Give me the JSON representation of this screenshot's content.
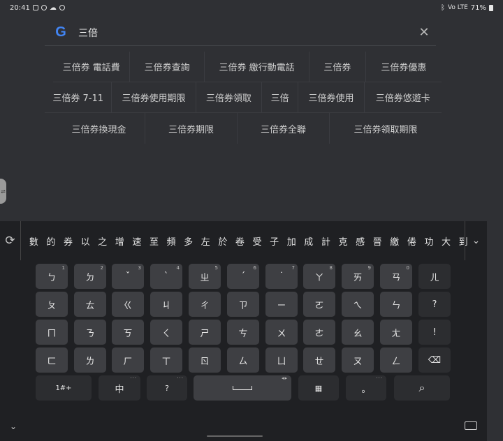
{
  "status": {
    "time": "20:41",
    "battery": "71%",
    "signal": "Vo LTE"
  },
  "search": {
    "query": "三倍",
    "clear_label": "✕",
    "logo": "G"
  },
  "suggestions": [
    [
      "三倍券 電話費",
      "三倍券查詢",
      "三倍券 繳行動電話",
      "三倍券",
      "三倍券優惠"
    ],
    [
      "三倍券 7-11",
      "三倍券使用期限",
      "三倍券領取",
      "三倍",
      "三倍券使用",
      "三倍券悠遊卡"
    ],
    [
      "三倍券換現金",
      "三倍券期限",
      "三倍券全聯",
      "三倍券領取期限"
    ]
  ],
  "keyboard": {
    "candidates": [
      "數",
      "的",
      "券",
      "以",
      "之",
      "增",
      "速",
      "至",
      "頻",
      "多",
      "左",
      "於",
      "卷",
      "受",
      "子",
      "加",
      "成",
      "計",
      "克",
      "感",
      "晉",
      "繳",
      "倦",
      "功",
      "大",
      "到"
    ],
    "rows": [
      [
        [
          "ㄅ",
          "1"
        ],
        [
          "ㄉ",
          "2"
        ],
        [
          "ˇ",
          "3"
        ],
        [
          "ˋ",
          "4"
        ],
        [
          "ㄓ",
          "5"
        ],
        [
          "ˊ",
          "6"
        ],
        [
          "˙",
          "7"
        ],
        [
          "ㄚ",
          "8"
        ],
        [
          "ㄞ",
          "9"
        ],
        [
          "ㄢ",
          "0"
        ],
        [
          "ㄦ",
          ""
        ]
      ],
      [
        [
          "ㄆ",
          ""
        ],
        [
          "ㄊ",
          ""
        ],
        [
          "ㄍ",
          ""
        ],
        [
          "ㄐ",
          ""
        ],
        [
          "ㄔ",
          ""
        ],
        [
          "ㄗ",
          ""
        ],
        [
          "ㄧ",
          ""
        ],
        [
          "ㄛ",
          ""
        ],
        [
          "ㄟ",
          ""
        ],
        [
          "ㄣ",
          ""
        ],
        [
          "?",
          ""
        ]
      ],
      [
        [
          "ㄇ",
          ""
        ],
        [
          "ㄋ",
          ""
        ],
        [
          "ㄎ",
          ""
        ],
        [
          "ㄑ",
          ""
        ],
        [
          "ㄕ",
          ""
        ],
        [
          "ㄘ",
          ""
        ],
        [
          "ㄨ",
          ""
        ],
        [
          "ㄜ",
          ""
        ],
        [
          "ㄠ",
          ""
        ],
        [
          "ㄤ",
          ""
        ],
        [
          "!",
          ""
        ]
      ],
      [
        [
          "ㄈ",
          ""
        ],
        [
          "ㄌ",
          ""
        ],
        [
          "ㄏ",
          ""
        ],
        [
          "ㄒ",
          ""
        ],
        [
          "ㄖ",
          ""
        ],
        [
          "ㄙ",
          ""
        ],
        [
          "ㄩ",
          ""
        ],
        [
          "ㄝ",
          ""
        ],
        [
          "ㄡ",
          ""
        ],
        [
          "ㄥ",
          ""
        ],
        [
          "⌫",
          ""
        ]
      ]
    ],
    "bottom": {
      "symbols": "1#+",
      "lang": "中",
      "question": "?",
      "period": "。",
      "search_icon": "🔍"
    }
  },
  "icons": {
    "candidate_toggle": "swap-icon",
    "expand": "chevron-down-icon",
    "nav_down": "chevron-down-icon",
    "nav_keyboard": "keyboard-icon"
  }
}
